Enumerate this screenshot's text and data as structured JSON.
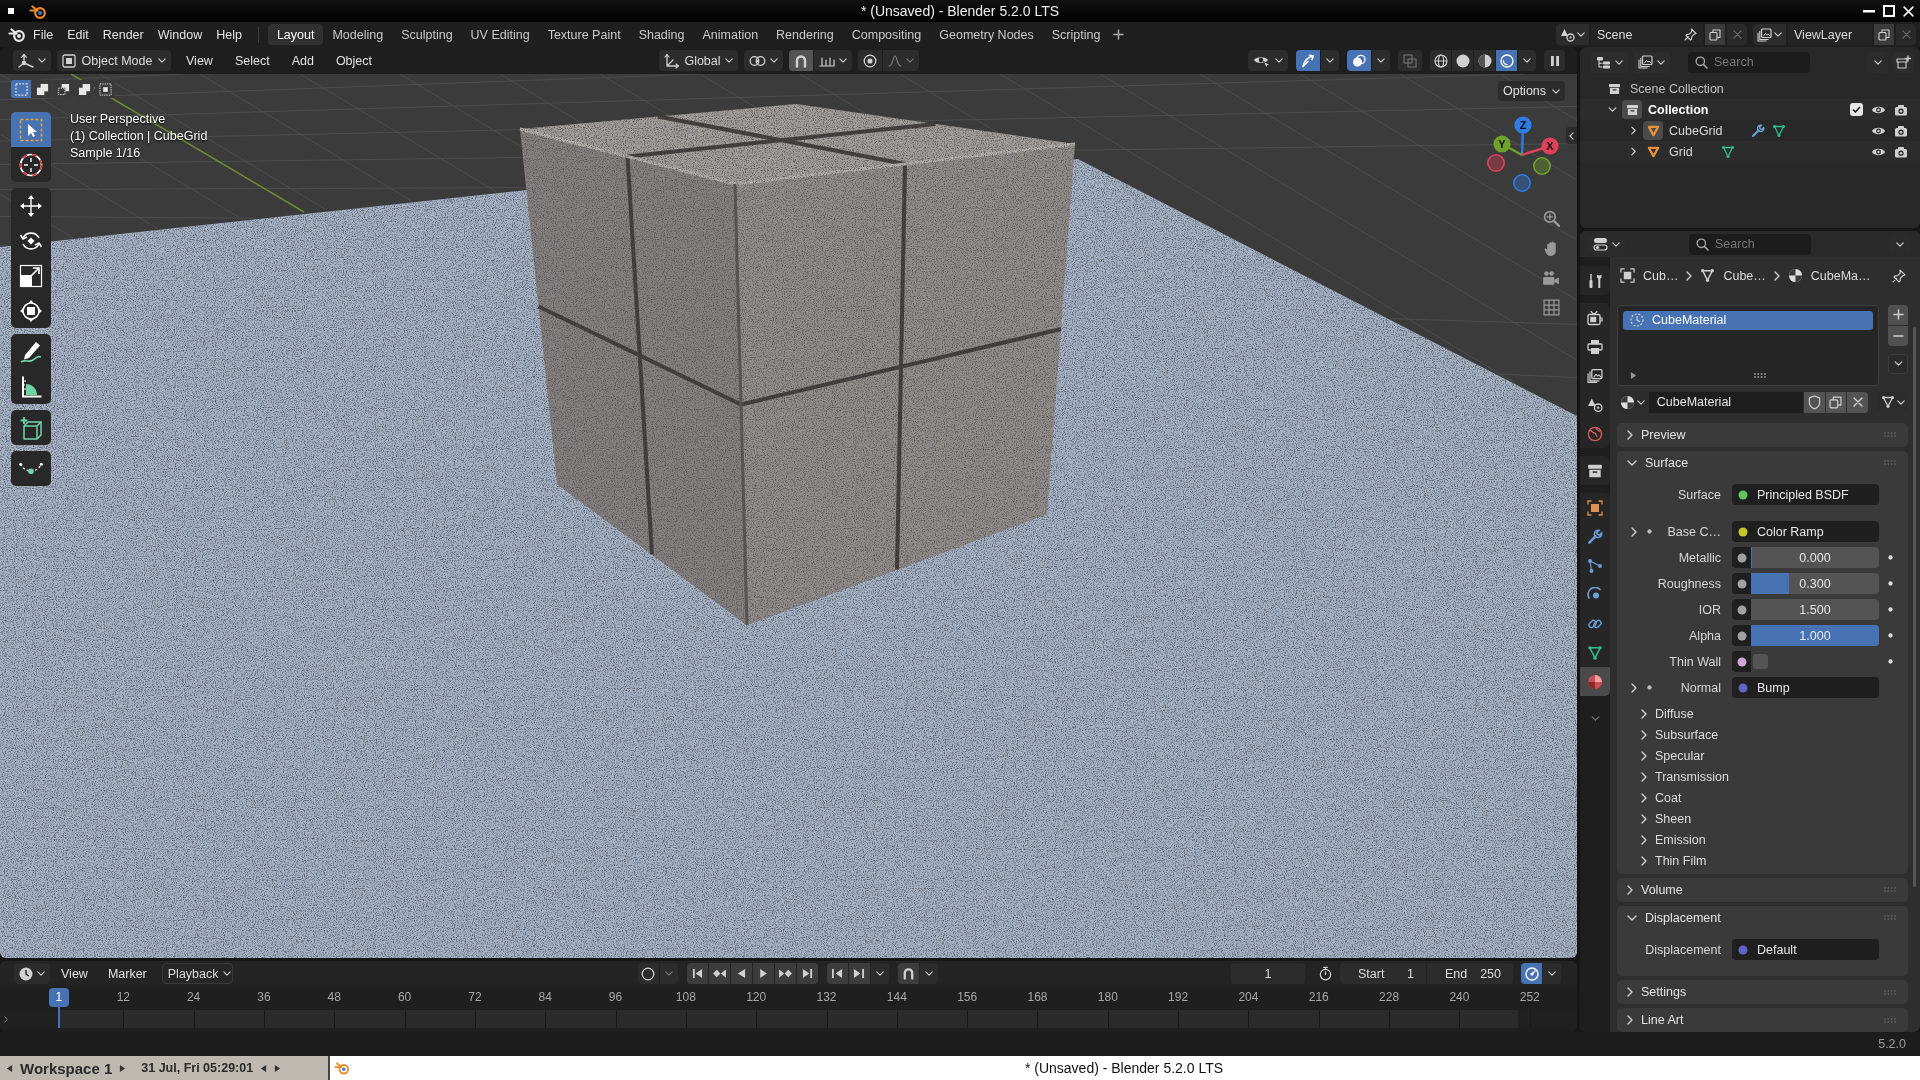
{
  "os_window": {
    "title": "* (Unsaved) - Blender 5.2.0 LTS"
  },
  "topbar": {
    "menus": [
      "File",
      "Edit",
      "Render",
      "Window",
      "Help"
    ],
    "workspaces": [
      {
        "label": "Layout",
        "selected": true
      },
      {
        "label": "Modeling",
        "selected": false
      },
      {
        "label": "Sculpting",
        "selected": false
      },
      {
        "label": "UV Editing",
        "selected": false
      },
      {
        "label": "Texture Paint",
        "selected": false
      },
      {
        "label": "Shading",
        "selected": false
      },
      {
        "label": "Animation",
        "selected": false
      },
      {
        "label": "Rendering",
        "selected": false
      },
      {
        "label": "Compositing",
        "selected": false
      },
      {
        "label": "Geometry Nodes",
        "selected": false
      },
      {
        "label": "Scripting",
        "selected": false
      }
    ],
    "scene": "Scene",
    "view_layer": "ViewLayer"
  },
  "viewport": {
    "mode": "Object Mode",
    "menus": [
      "View",
      "Select",
      "Add",
      "Object"
    ],
    "orientation": "Global",
    "gizmos_on": true,
    "overlays_on": true,
    "xray_on": false,
    "shading": [
      {
        "kind": "wireframe",
        "selected": false
      },
      {
        "kind": "solid",
        "selected": false
      },
      {
        "kind": "material",
        "selected": false
      },
      {
        "kind": "rendered",
        "selected": true
      }
    ],
    "options": "Options",
    "select_modes": [
      {
        "kind": "set",
        "selected": true
      },
      {
        "kind": "extend",
        "selected": false
      },
      {
        "kind": "subtract",
        "selected": false
      },
      {
        "kind": "invert",
        "selected": false
      },
      {
        "kind": "intersect",
        "selected": false
      }
    ],
    "info": [
      "User Perspective",
      "(1) Collection | CubeGrid",
      "Sample 1/16"
    ],
    "tool_groups": [
      [
        {
          "kind": "select_box",
          "selected": true
        },
        {
          "kind": "cursor",
          "selected": false
        }
      ],
      [
        {
          "kind": "move",
          "selected": false
        },
        {
          "kind": "rotate",
          "selected": false
        },
        {
          "kind": "scale",
          "selected": false
        },
        {
          "kind": "transform",
          "selected": false
        }
      ],
      [
        {
          "kind": "annotate",
          "selected": false
        },
        {
          "kind": "measure",
          "selected": false
        }
      ],
      [
        {
          "kind": "add_cube",
          "selected": false
        }
      ],
      [
        {
          "kind": "curve",
          "selected": false
        }
      ]
    ],
    "gizmo_axes": [
      {
        "label": "Z",
        "color": "#2e7ce6"
      },
      {
        "label": "Y",
        "color": "#6ea22a"
      },
      {
        "label": "X",
        "color": "#e1405a"
      }
    ]
  },
  "outliner": {
    "search_placeholder": "Search",
    "tree": [
      {
        "label": "Scene Collection",
        "kind": "scene_collection",
        "active": false,
        "children": [
          {
            "label": "Collection",
            "kind": "collection",
            "expanded": true,
            "active": true,
            "included": true,
            "children": [
              {
                "label": "CubeGrid",
                "kind": "object",
                "expanded": false,
                "active": true,
                "has_modifier": true
              },
              {
                "label": "Grid",
                "kind": "object",
                "expanded": false,
                "active": false,
                "has_modifier": false
              }
            ]
          }
        ]
      }
    ]
  },
  "properties": {
    "search_placeholder": "Search",
    "tab_groups": [
      [
        {
          "kind": "tool",
          "selected": false
        }
      ],
      [
        {
          "kind": "render",
          "selected": false
        },
        {
          "kind": "output",
          "selected": false
        },
        {
          "kind": "view_layer",
          "selected": false
        },
        {
          "kind": "scene",
          "selected": false
        },
        {
          "kind": "world",
          "selected": false
        }
      ],
      [
        {
          "kind": "collection",
          "selected": false
        }
      ],
      [
        {
          "kind": "object",
          "selected": false
        },
        {
          "kind": "modifiers",
          "selected": false
        },
        {
          "kind": "particles",
          "selected": false
        },
        {
          "kind": "physics",
          "selected": false
        },
        {
          "kind": "constraints",
          "selected": false
        },
        {
          "kind": "data",
          "selected": false
        },
        {
          "kind": "material",
          "selected": true
        }
      ]
    ],
    "breadcrumb": [
      {
        "kind": "object",
        "label": "Cub…"
      },
      {
        "kind": "mesh",
        "label": "Cube…"
      },
      {
        "kind": "material",
        "label": "CubeMa…"
      }
    ],
    "material_slots": [
      {
        "name": "CubeMaterial",
        "selected": true
      }
    ],
    "material": "CubeMaterial",
    "panels": [
      {
        "title": "Preview",
        "expanded": false
      },
      {
        "title": "Surface",
        "expanded": true,
        "rows": [
          {
            "kind": "link",
            "label": "Surface",
            "value": "Principled BSDF",
            "color": "#5ec45e",
            "expandable": false
          },
          {
            "kind": "link",
            "label": "Base C…",
            "value": "Color Ramp",
            "color": "#c7c729",
            "expandable": true
          },
          {
            "kind": "slider",
            "label": "Metallic",
            "value": "0.000",
            "level": 0,
            "color": "#a1a1a1"
          },
          {
            "kind": "slider",
            "label": "Roughness",
            "value": "0.300",
            "level": 0.3,
            "color": "#a1a1a1"
          },
          {
            "kind": "number",
            "label": "IOR",
            "value": "1.500",
            "color": "#a1a1a1"
          },
          {
            "kind": "slider",
            "label": "Alpha",
            "value": "1.000",
            "level": 1,
            "color": "#a1a1a1"
          },
          {
            "kind": "checkbox",
            "label": "Thin Wall",
            "checked": false,
            "color": "#cca6d6"
          },
          {
            "kind": "link",
            "label": "Normal",
            "value": "Bump",
            "color": "#6363c7",
            "expandable": true
          },
          {
            "kind": "subpanel",
            "label": "Diffuse",
            "expanded": false
          },
          {
            "kind": "subpanel",
            "label": "Subsurface",
            "expanded": false
          },
          {
            "kind": "subpanel",
            "label": "Specular",
            "expanded": false
          },
          {
            "kind": "subpanel",
            "label": "Transmission",
            "expanded": false
          },
          {
            "kind": "subpanel",
            "label": "Coat",
            "expanded": false
          },
          {
            "kind": "subpanel",
            "label": "Sheen",
            "expanded": false
          },
          {
            "kind": "subpanel",
            "label": "Emission",
            "expanded": false
          },
          {
            "kind": "subpanel",
            "label": "Thin Film",
            "expanded": false
          }
        ]
      },
      {
        "title": "Volume",
        "expanded": false
      },
      {
        "title": "Displacement",
        "expanded": true,
        "rows": [
          {
            "kind": "link",
            "label": "Displacement",
            "value": "Default",
            "color": "#6363c7",
            "expandable": false
          }
        ]
      },
      {
        "title": "Settings",
        "expanded": false
      },
      {
        "title": "Line Art",
        "expanded": false
      }
    ]
  },
  "timeline": {
    "menus": [
      "View",
      "Marker"
    ],
    "playback": "Playback",
    "current_frame": "1",
    "start_label": "Start",
    "start": "1",
    "end_label": "End",
    "end": "250",
    "playhead": "1",
    "ticks": [
      "12",
      "24",
      "36",
      "48",
      "60",
      "72",
      "84",
      "96",
      "108",
      "120",
      "132",
      "144",
      "156",
      "168",
      "180",
      "192",
      "204",
      "216",
      "228",
      "240",
      "252"
    ]
  },
  "status_bar": {
    "version": "5.2.0"
  },
  "taskbar": {
    "workspace": "Workspace 1",
    "clock": "31 Jul, Fri 05:29:01",
    "window_title": "* (Unsaved) - Blender 5.2.0 LTS"
  }
}
